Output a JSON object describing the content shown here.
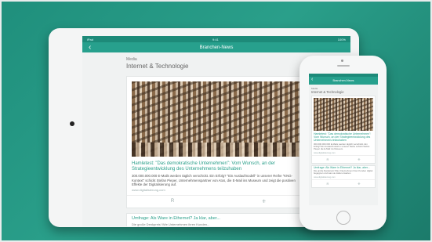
{
  "tablet": {
    "status_left": "iPad",
    "status_center": "9:41",
    "status_right": "100%",
    "nav_title": "Branchen-News",
    "back_icon": "chevron-left-icon",
    "kicker": "Media",
    "section_title": "Internet & Technologie",
    "article1": {
      "headline": "Hamletest: \"Das demokratische Unternehmen\": Vom Wunsch, an der Strategieentwicklung des Unternehmens teilzuhaben",
      "text": "300.000.000.000 E-Mails werden täglich verschickt. Ein Erfolg? \"Ein Auslaufmodell\" in unserer Reihe \"KNG-Kontext\" schickt Stefan Pieper, Unternehmenspartner von Atos, die E-Mail ins Museum und zeigt die positiven Effekte der Digitalisierung auf.",
      "url": "www.digitalisierung.com",
      "action_left": "R",
      "action_right": "⁜"
    },
    "article2": {
      "headline": "Umfrage: Als Ware in Ethernet? Ja klar, aber...",
      "text": "Die große Denkpreis! Wie Unternehmen ihren Kunden..."
    }
  },
  "phone": {
    "nav_title": "Branchen-News",
    "back_icon": "chevron-left-icon",
    "kicker": "Media",
    "section_title": "Internet & Technologie",
    "article1": {
      "headline": "Hamletest: \"Das demokratische Unternehmen\": Vom Wunsch, an der Strategieentwicklung des Unternehmens teilzuhaben",
      "text": "300.000.000.000 E-Mails werden täglich verschickt. Ein Erfolg? Ein Auslaufmodell in unserer Reihe schickt Stefan Pieper die E-Mail ins Museum.",
      "url": "www.digitalisierung.com",
      "action_left": "R",
      "action_right": "⁜"
    },
    "article2": {
      "headline": "Umfrage: Als Ware in Ethernet? Ja klar, aber...",
      "text": "Die große Denkpreis! Wie Unternehmen ihren Kunden digital begegnen und was sie dabei erwarten.",
      "url": "www.digitalisierung.com",
      "action_left": "R",
      "action_right": "⁜"
    }
  },
  "colors": {
    "background": "#2a9f8a",
    "accent": "#27a08d"
  }
}
